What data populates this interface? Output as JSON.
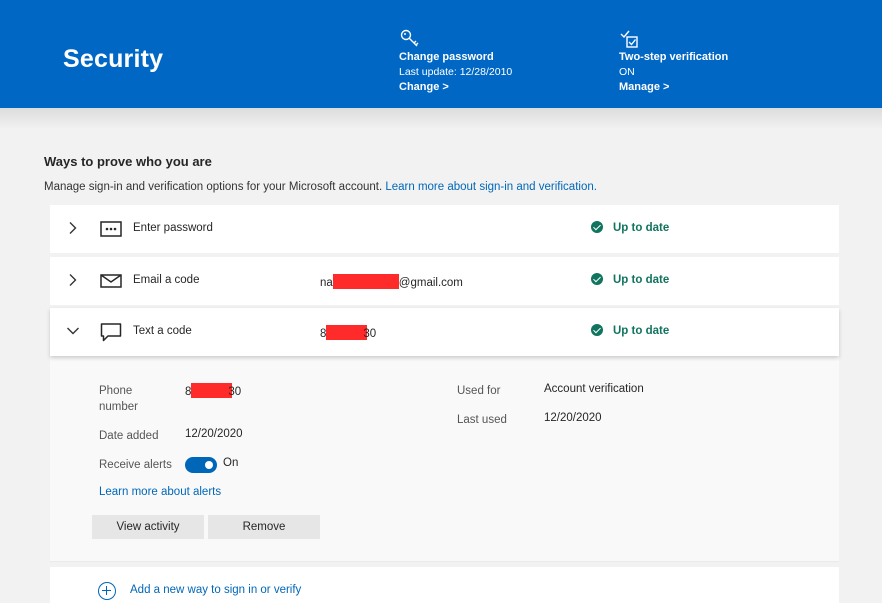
{
  "header": {
    "title": "Security",
    "password": {
      "title": "Change password",
      "subtitle": "Last update: 12/28/2010",
      "link": "Change >"
    },
    "two_step": {
      "title": "Two-step verification",
      "subtitle": "ON",
      "link": "Manage >"
    }
  },
  "section": {
    "title": "Ways to prove who you are",
    "description": "Manage sign-in and verification options for your Microsoft account. ",
    "link": "Learn more about sign-in and verification."
  },
  "methods": [
    {
      "label": "Enter password",
      "value_prefix": "",
      "value_suffix": "",
      "status": "Up to date",
      "icon": "password-dots-icon"
    },
    {
      "label": "Email a code",
      "value_prefix": "na",
      "value_suffix": "@gmail.com",
      "status": "Up to date",
      "icon": "envelope-icon"
    },
    {
      "label": "Text a code",
      "value_prefix": "8",
      "value_suffix": "30",
      "status": "Up to date",
      "icon": "chat-bubble-icon"
    }
  ],
  "detail": {
    "phone_label": "Phone number",
    "phone_prefix": "8",
    "phone_suffix": "30",
    "date_added_label": "Date added",
    "date_added": "12/20/2020",
    "alerts_label": "Receive alerts",
    "alerts_state": "On",
    "alerts_link": "Learn more about alerts",
    "used_for_label": "Used for",
    "used_for": "Account verification",
    "last_used_label": "Last used",
    "last_used": "12/20/2020",
    "view_activity": "View activity",
    "remove": "Remove"
  },
  "add": {
    "label": "Add a new way to sign in or verify"
  },
  "colors": {
    "header_bg": "#0067c5",
    "status_green": "#10745e",
    "link_blue": "#0067b8",
    "redaction": "#ff2a2a"
  }
}
